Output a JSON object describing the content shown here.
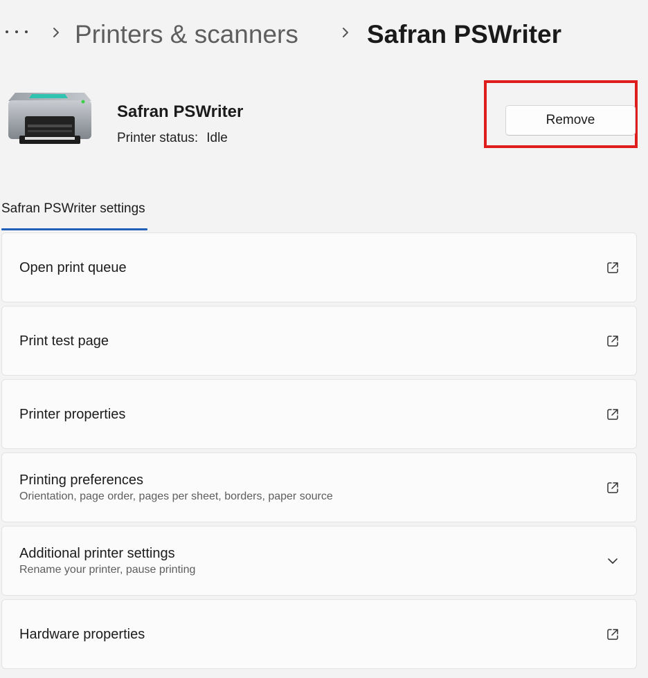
{
  "breadcrumb": {
    "more_label": "More",
    "parent": "Printers & scanners",
    "current": "Safran PSWriter"
  },
  "printer": {
    "name": "Safran PSWriter",
    "status_label": "Printer status:",
    "status_value": "Idle",
    "remove_label": "Remove"
  },
  "section": {
    "tab_label": "Safran PSWriter settings"
  },
  "settings": [
    {
      "title": "Open print queue",
      "description": "",
      "icon": "open-external-icon"
    },
    {
      "title": "Print test page",
      "description": "",
      "icon": "open-external-icon"
    },
    {
      "title": "Printer properties",
      "description": "",
      "icon": "open-external-icon"
    },
    {
      "title": "Printing preferences",
      "description": "Orientation, page order, pages per sheet, borders, paper source",
      "icon": "open-external-icon"
    },
    {
      "title": "Additional printer settings",
      "description": "Rename your printer, pause printing",
      "icon": "chevron-down-icon"
    },
    {
      "title": "Hardware properties",
      "description": "",
      "icon": "open-external-icon"
    }
  ],
  "colors": {
    "background": "#f3f3f3",
    "card": "#fbfbfb",
    "accent": "#1f5fb8",
    "highlight": "#e01d1d"
  }
}
